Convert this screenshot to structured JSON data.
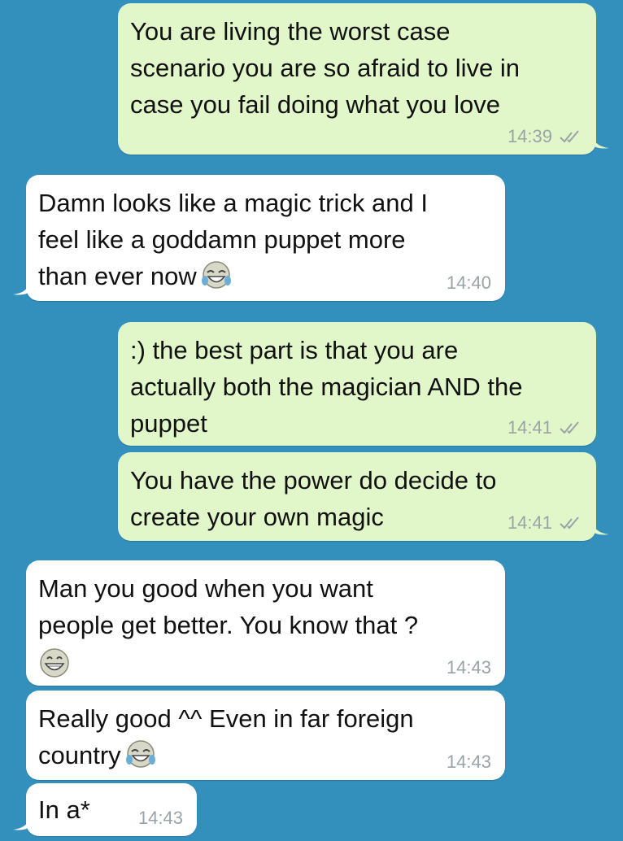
{
  "colors": {
    "background": "#3390bd",
    "outgoing": "#e1f7c9",
    "incoming": "#ffffff",
    "timestamp": "#9aa3a6"
  },
  "messages": [
    {
      "dir": "out",
      "text": "You are living the worst case\nscenario you are so afraid to live in\ncase you fail doing what you love",
      "time": "14:39",
      "read": true
    },
    {
      "dir": "in",
      "text": "Damn looks like a magic trick and I\nfeel like a goddamn puppet more\nthan ever now",
      "emoji": "tears-of-joy",
      "time": "14:40"
    },
    {
      "dir": "out",
      "text": ":) the best part is that you are\nactually both the magician AND the\npuppet",
      "time": "14:41",
      "read": true
    },
    {
      "dir": "out",
      "text": "You have the power do decide to\ncreate your own magic",
      "time": "14:41",
      "read": true
    },
    {
      "dir": "in",
      "text": "Man you good when you want\npeople get better. You know that ?",
      "emoji_line": "grinning",
      "time": "14:43"
    },
    {
      "dir": "in",
      "text": "Really good ^^ Even in far foreign\ncountry",
      "emoji": "tears-of-joy",
      "time": "14:43"
    },
    {
      "dir": "in",
      "text": "In a*",
      "time": "14:43"
    }
  ]
}
